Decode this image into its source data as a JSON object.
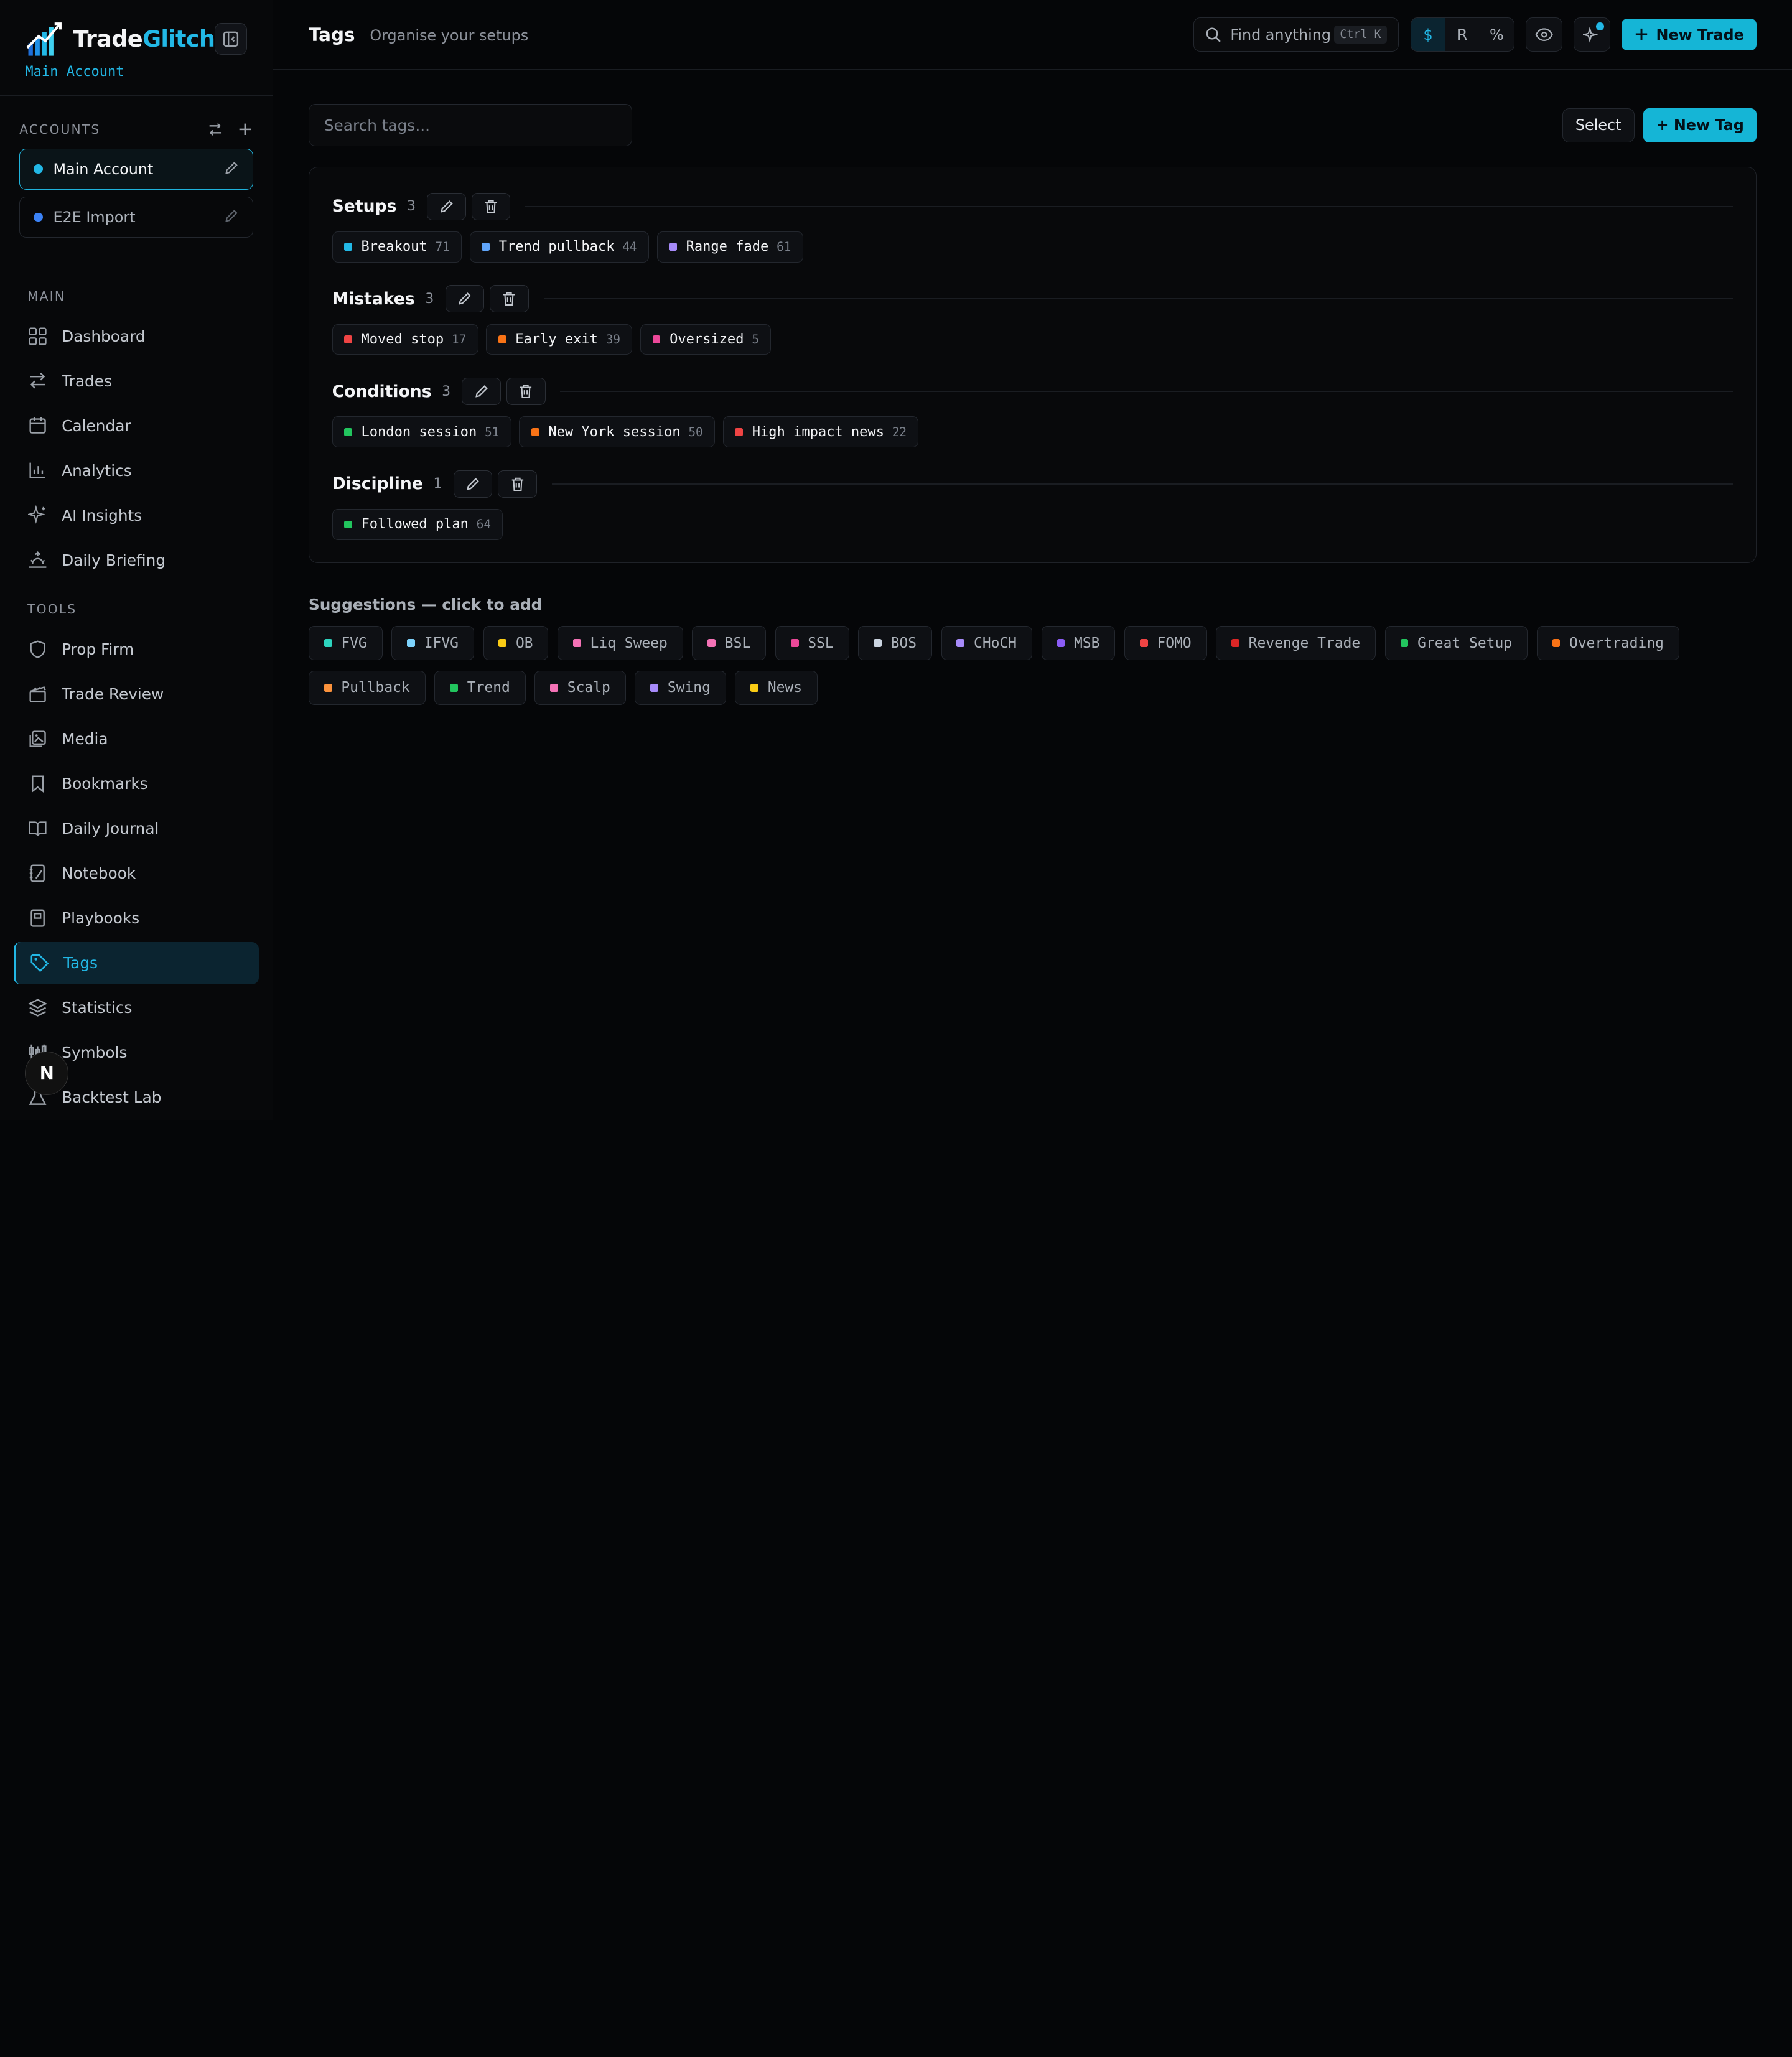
{
  "brand": {
    "name_a": "Trade",
    "name_b": "Glitch",
    "account_label": "Main Account"
  },
  "accounts": {
    "label": "ACCOUNTS",
    "items": [
      {
        "name": "Main Account",
        "color": "#22b8e6",
        "active": true
      },
      {
        "name": "E2E Import",
        "color": "#3b82f6",
        "active": false
      }
    ]
  },
  "nav": {
    "main_label": "MAIN",
    "main_items": [
      {
        "label": "Dashboard",
        "icon": "grid-icon"
      },
      {
        "label": "Trades",
        "icon": "arrows-icon"
      },
      {
        "label": "Calendar",
        "icon": "calendar-icon"
      },
      {
        "label": "Analytics",
        "icon": "bar-chart-icon"
      },
      {
        "label": "AI Insights",
        "icon": "sparkles-icon"
      },
      {
        "label": "Daily Briefing",
        "icon": "sunrise-icon"
      }
    ],
    "tools_label": "TOOLS",
    "tools_items": [
      {
        "label": "Prop Firm",
        "icon": "shield-icon"
      },
      {
        "label": "Trade Review",
        "icon": "clapper-icon"
      },
      {
        "label": "Media",
        "icon": "images-icon"
      },
      {
        "label": "Bookmarks",
        "icon": "bookmark-icon"
      },
      {
        "label": "Daily Journal",
        "icon": "book-open-icon"
      },
      {
        "label": "Notebook",
        "icon": "notebook-icon"
      },
      {
        "label": "Playbooks",
        "icon": "playbook-icon"
      },
      {
        "label": "Tags",
        "icon": "tag-icon",
        "active": true
      },
      {
        "label": "Statistics",
        "icon": "layers-icon"
      },
      {
        "label": "Symbols",
        "icon": "candles-icon"
      },
      {
        "label": "Backtest Lab",
        "icon": "flask-icon"
      }
    ]
  },
  "badge_letter": "N",
  "header": {
    "title": "Tags",
    "subtitle": "Organise your setups",
    "search_placeholder": "Find anything",
    "search_shortcut": "Ctrl K",
    "units": [
      "$",
      "R",
      "%"
    ],
    "new_trade": "New Trade"
  },
  "toolbar": {
    "search_placeholder": "Search tags...",
    "select_label": "Select",
    "new_tag_label": "+ New Tag"
  },
  "groups": [
    {
      "name": "Setups",
      "count": "3",
      "tags": [
        {
          "label": "Breakout",
          "count": "71",
          "color": "#22b8e6"
        },
        {
          "label": "Trend pullback",
          "count": "44",
          "color": "#60a5fa"
        },
        {
          "label": "Range fade",
          "count": "61",
          "color": "#a78bfa"
        }
      ]
    },
    {
      "name": "Mistakes",
      "count": "3",
      "tags": [
        {
          "label": "Moved stop",
          "count": "17",
          "color": "#ef4444"
        },
        {
          "label": "Early exit",
          "count": "39",
          "color": "#f97316"
        },
        {
          "label": "Oversized",
          "count": "5",
          "color": "#ec4899"
        }
      ]
    },
    {
      "name": "Conditions",
      "count": "3",
      "tags": [
        {
          "label": "London session",
          "count": "51",
          "color": "#22c55e"
        },
        {
          "label": "New York session",
          "count": "50",
          "color": "#f97316"
        },
        {
          "label": "High impact news",
          "count": "22",
          "color": "#ef4444"
        }
      ]
    },
    {
      "name": "Discipline",
      "count": "1",
      "tags": [
        {
          "label": "Followed plan",
          "count": "64",
          "color": "#22c55e"
        }
      ]
    }
  ],
  "suggestions": {
    "title": "Suggestions — click to add",
    "items": [
      {
        "label": "FVG",
        "color": "#2dd4bf"
      },
      {
        "label": "IFVG",
        "color": "#7dd3fc"
      },
      {
        "label": "OB",
        "color": "#facc15"
      },
      {
        "label": "Liq Sweep",
        "color": "#f472b6"
      },
      {
        "label": "BSL",
        "color": "#f472b6"
      },
      {
        "label": "SSL",
        "color": "#ec4899"
      },
      {
        "label": "BOS",
        "color": "#cbd5e1"
      },
      {
        "label": "CHoCH",
        "color": "#a78bfa"
      },
      {
        "label": "MSB",
        "color": "#8b5cf6"
      },
      {
        "label": "FOMO",
        "color": "#ef4444"
      },
      {
        "label": "Revenge Trade",
        "color": "#dc2626"
      },
      {
        "label": "Great Setup",
        "color": "#22c55e"
      },
      {
        "label": "Overtrading",
        "color": "#f97316"
      },
      {
        "label": "Pullback",
        "color": "#fb923c"
      },
      {
        "label": "Trend",
        "color": "#22c55e"
      },
      {
        "label": "Scalp",
        "color": "#f472b6"
      },
      {
        "label": "Swing",
        "color": "#a78bfa"
      },
      {
        "label": "News",
        "color": "#facc15"
      }
    ]
  }
}
